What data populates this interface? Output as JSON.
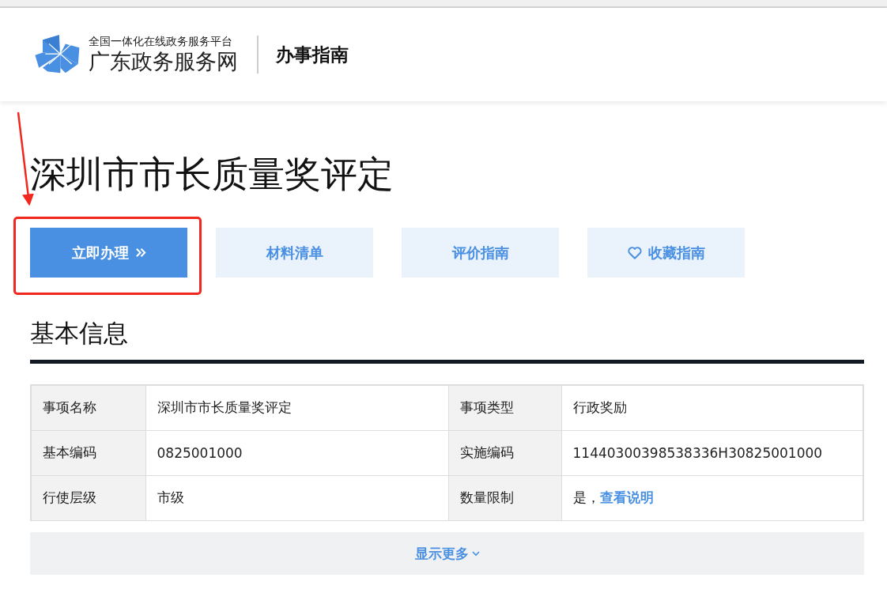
{
  "header": {
    "platform_subtitle": "全国一体化在线政务服务平台",
    "site_name": "广东政务服务网",
    "section": "办事指南"
  },
  "title": "深圳市市长质量奖评定",
  "actions": [
    {
      "label": "立即办理",
      "kind": "primary",
      "highlighted": true
    },
    {
      "label": "材料清单",
      "kind": "secondary"
    },
    {
      "label": "评价指南",
      "kind": "secondary"
    },
    {
      "label": "收藏指南",
      "kind": "favorite"
    }
  ],
  "basic_info": {
    "heading": "基本信息",
    "rows": [
      [
        {
          "label": "事项名称",
          "value": "深圳市市长质量奖评定"
        },
        {
          "label": "事项类型",
          "value": "行政奖励"
        }
      ],
      [
        {
          "label": "基本编码",
          "value": "0825001000"
        },
        {
          "label": "实施编码",
          "value": "11440300398538336H30825001000"
        }
      ],
      [
        {
          "label": "行使层级",
          "value": "市级"
        },
        {
          "label": "数量限制",
          "value": "是，",
          "link": "查看说明"
        }
      ]
    ],
    "show_more": "显示更多"
  }
}
